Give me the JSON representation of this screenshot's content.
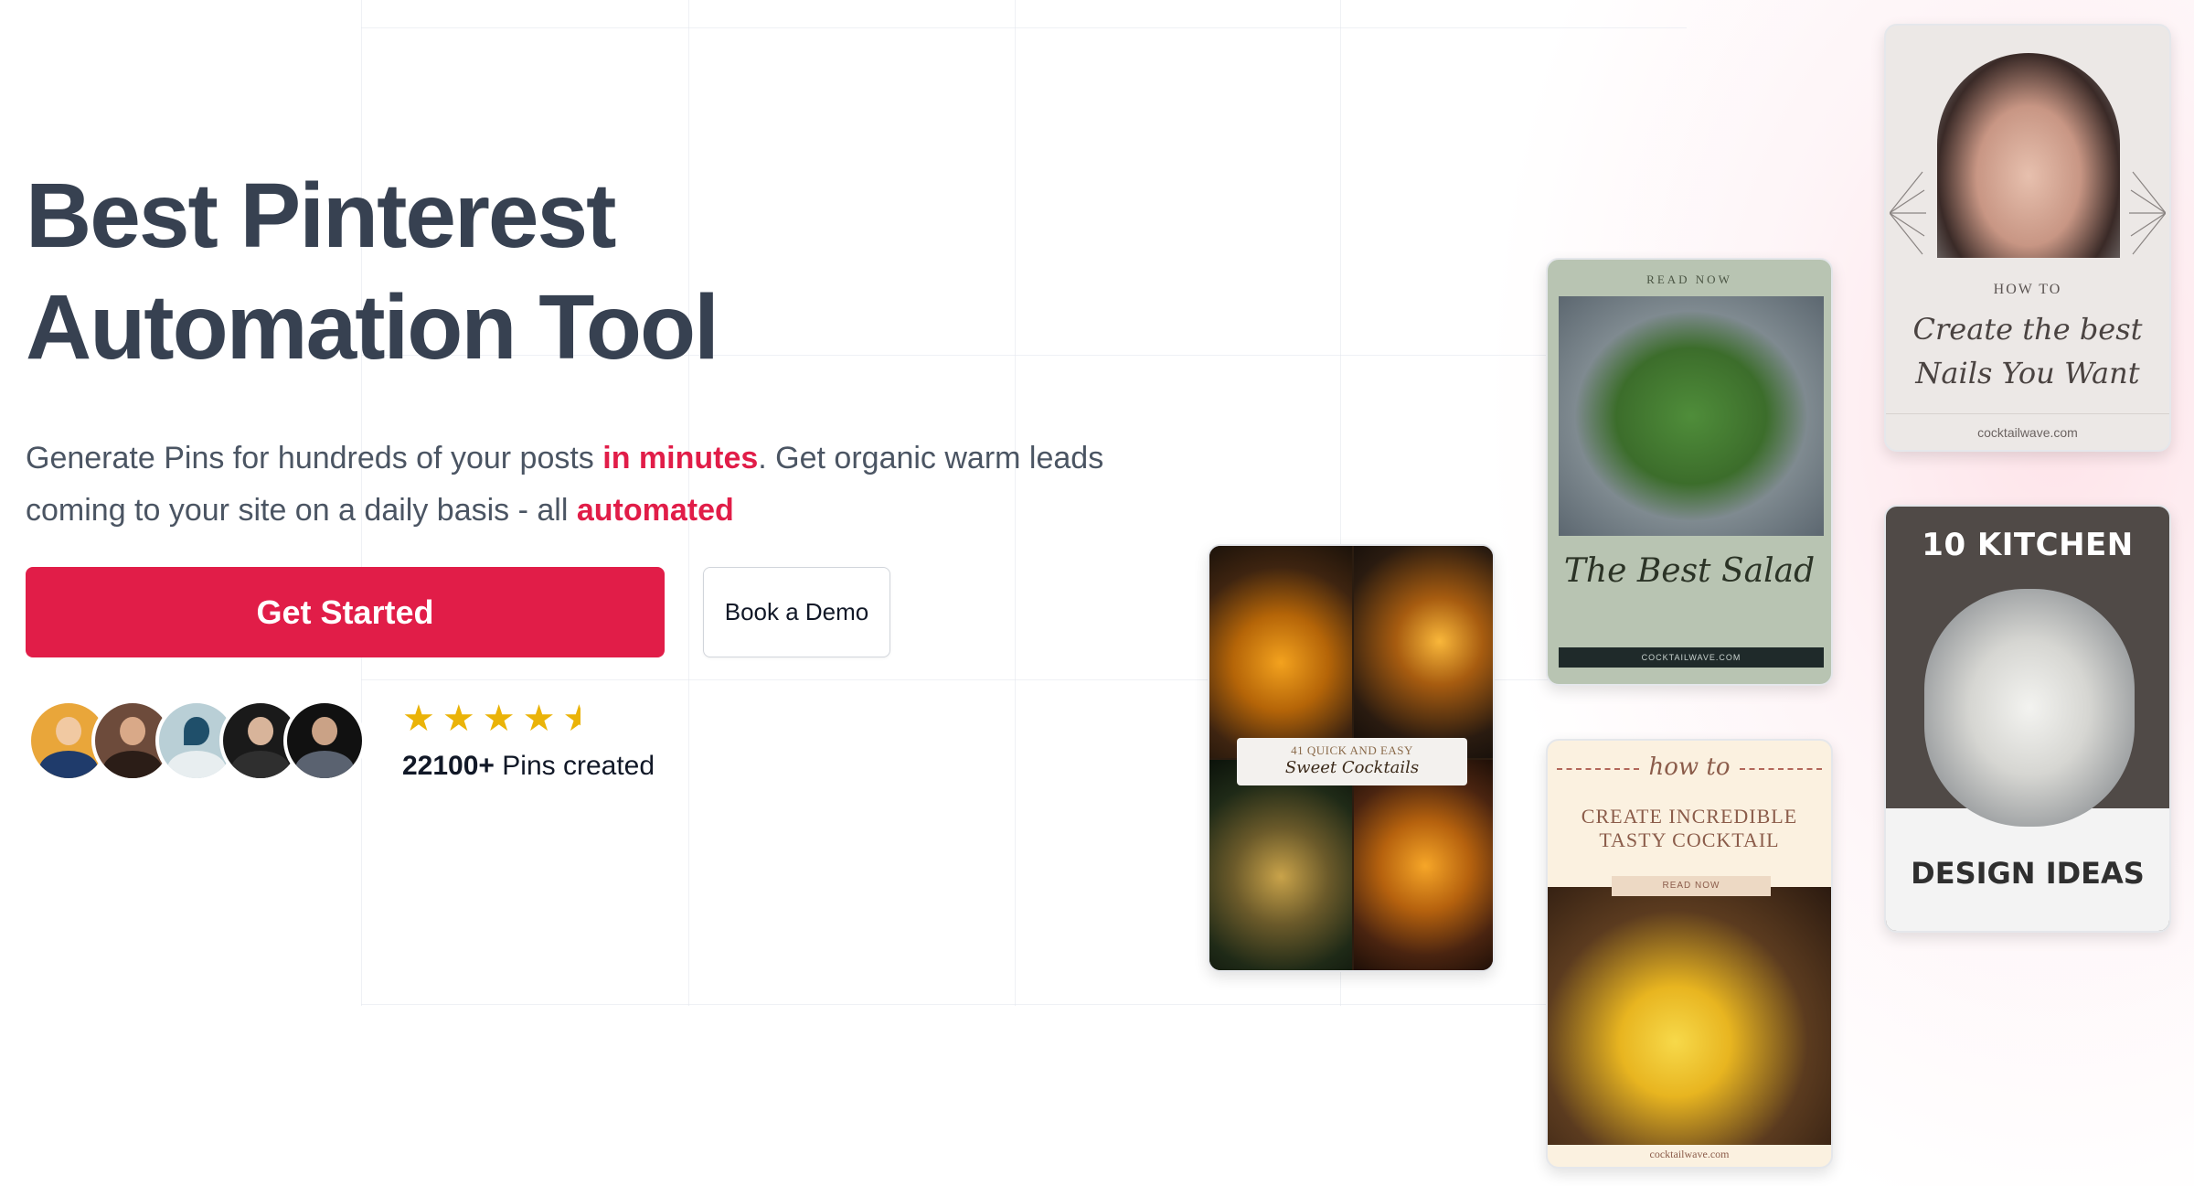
{
  "hero": {
    "title_line1": "Best Pinterest",
    "title_line2": "Automation Tool",
    "subtitle_part1": "Generate Pins for hundreds of your posts ",
    "subtitle_highlight1": "in minutes",
    "subtitle_part2": ". Get organic warm leads coming to your site on a daily basis - all ",
    "subtitle_highlight2": "automated"
  },
  "cta": {
    "primary_label": "Get Started",
    "secondary_label": "Book a Demo"
  },
  "social_proof": {
    "rating_stars": 4.5,
    "pins_count": "22100+",
    "pins_label": " Pins created"
  },
  "pins": {
    "cocktails": {
      "small": "41 QUICK AND EASY",
      "script": "Sweet Cocktails"
    },
    "salad": {
      "top": "READ NOW",
      "title": "The Best Salad",
      "foot": "COCKTAILWAVE.COM"
    },
    "tasty": {
      "how": "how to",
      "title_line1": "CREATE INCREDIBLE",
      "title_line2": "TASTY COCKTAIL",
      "button": "READ NOW",
      "foot": "cocktailwave.com"
    },
    "nails": {
      "how": "HOW TO",
      "script_line1": "Create the best",
      "script_line2": "Nails You Want",
      "foot": "cocktailwave.com"
    },
    "kitchen": {
      "top": "10 KITCHEN",
      "bottom": "DESIGN IDEAS"
    }
  },
  "colors": {
    "accent": "#e11d48",
    "heading": "#374151",
    "star": "#eab308"
  }
}
